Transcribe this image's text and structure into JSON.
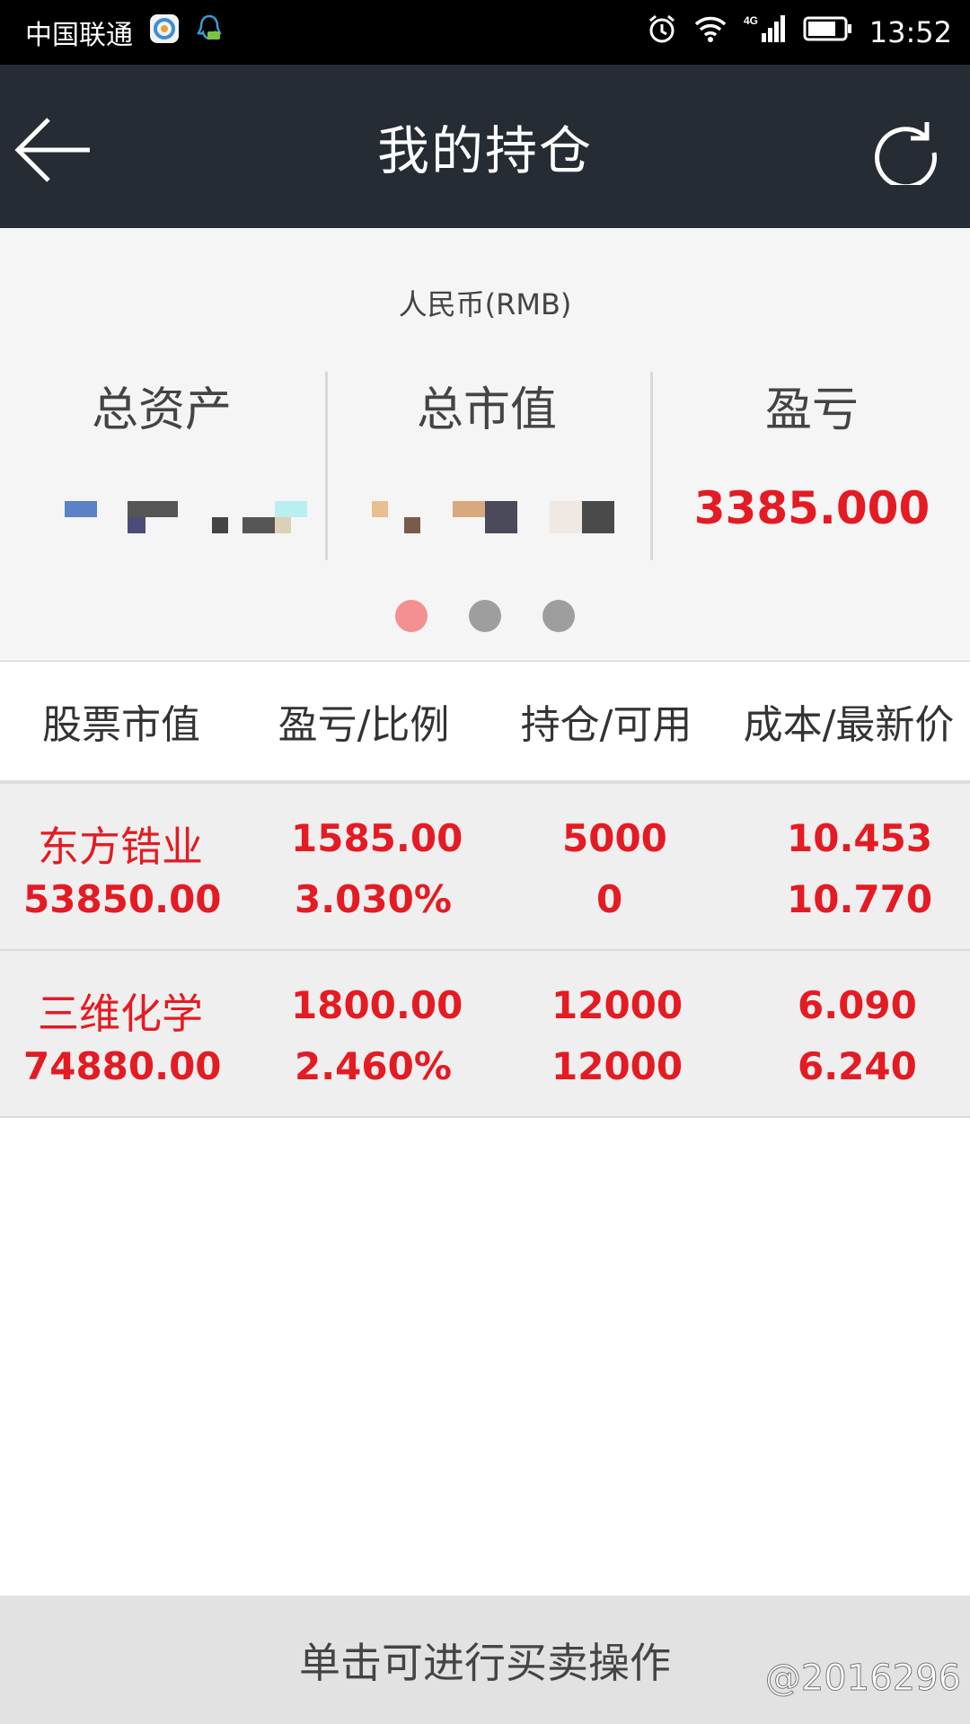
{
  "status_bar": {
    "carrier": "中国联通",
    "time": "13:52",
    "network": "4G"
  },
  "header": {
    "title": "我的持仓"
  },
  "summary": {
    "currency": "人民币(RMB)",
    "total_assets_label": "总资产",
    "total_market_value_label": "总市值",
    "pnl_label": "盈亏",
    "pnl_value": "3385.000",
    "page_indicator": {
      "current": 1,
      "total": 3
    }
  },
  "table": {
    "headers": [
      "股票市值",
      "盈亏/比例",
      "持仓/可用",
      "成本/最新价"
    ],
    "rows": [
      {
        "name": "东方锆业",
        "market_value": "53850.00",
        "pnl": "1585.00",
        "pnl_ratio": "3.030%",
        "position": "5000",
        "available": "0",
        "cost": "10.453",
        "latest_price": "10.770"
      },
      {
        "name": "三维化学",
        "market_value": "74880.00",
        "pnl": "1800.00",
        "pnl_ratio": "2.460%",
        "position": "12000",
        "available": "12000",
        "cost": "6.090",
        "latest_price": "6.240"
      }
    ]
  },
  "footer": {
    "hint": "单击可进行买卖操作",
    "watermark": "@2016296"
  },
  "colors": {
    "accent_red": "#e41b23",
    "header_bg": "#252c33",
    "dot_active": "#f48f92",
    "dot_inactive": "#9e9e9e"
  }
}
